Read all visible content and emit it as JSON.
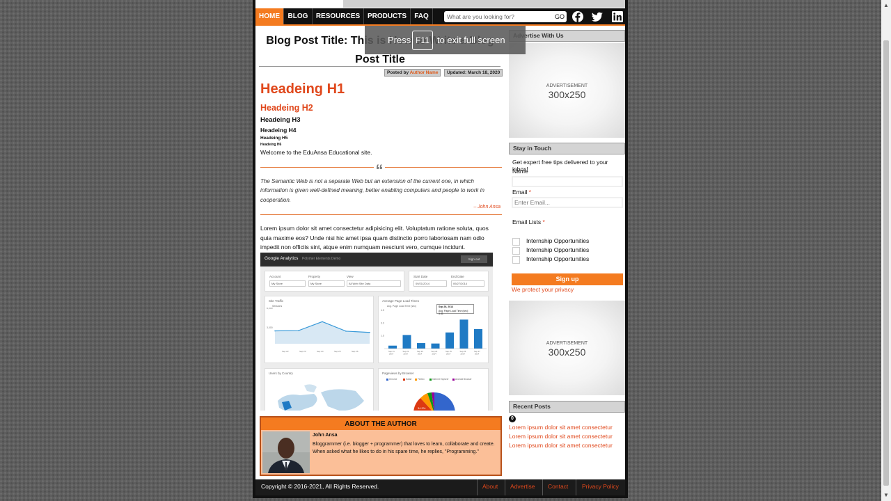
{
  "nav": {
    "items": [
      "HOME",
      "BLOG",
      "RESOURCES",
      "PRODUCTS",
      "FAQ"
    ],
    "active": "HOME",
    "search_placeholder": "What are you looking for?",
    "search_button": "GO",
    "social_icons": [
      "facebook-icon",
      "twitter-icon",
      "linkedin-icon"
    ]
  },
  "fullscreen_notice": {
    "press": "Press",
    "key": "F11",
    "tail": "to exit full screen"
  },
  "post": {
    "title": "Blog Post Title: This is How to Write a Blog Post Title",
    "posted_by_prefix": "Posted by",
    "author": "Author Name",
    "updated": "Updated: March 18, 2020",
    "h1": "Headeing H1",
    "h2": "Headeing H2",
    "h3": "Headeing H3",
    "h4": "Headeing H4",
    "h5": "Headeing H5",
    "h6": "Headeing H6",
    "welcome": "Welcome to the EduAnsa Educational site.",
    "quote": "The Semantic Web is not a separate Web but an extension of the current one, in which information is given well-defined meaning, better enabling computers and people to work in cooperation.",
    "quote_author": "–  John Ansa",
    "lorem": "Lorem ipsum dolor sit amet consectetur adipisicing elit. Voluptatum ratione soluta, quos quia maxime eos? Unde nisi hic amet ipsa quam distinctio porro laboriosam nam odio impedit non officiis sint, atque enim numquam nesciunt vero, cumque incidunt."
  },
  "analytics_image": {
    "title": "Google Analytics",
    "subtitle": "Polymer Elements Demo",
    "button": "Sign out",
    "labels": {
      "account": "Account",
      "property": "Property",
      "view": "View",
      "start": "Start Date",
      "end": "End Date",
      "account_val": "My Store",
      "property_val": "My Store",
      "view_val": "All Web Site Data",
      "start_val": "09/21/2014",
      "end_val": "09/27/2014",
      "traffic": "Site Traffic",
      "sessions": "Sessions",
      "load": "Average Page Load Times",
      "load_legend": "Avg. Page Load Time (sec)",
      "tooltip_date": "Sep 26, 2014",
      "tooltip_value": "Avg. Page Load Time (sec): 3.41",
      "country": "Users by Country",
      "browser": "Pageviews by Browser",
      "browsers": [
        "Chrome",
        "Safari",
        "Firefox",
        "Internet Explorer",
        "Android Browser"
      ],
      "pie_label": "34.3%"
    },
    "site_traffic_y": [
      "6,000",
      "3,000"
    ],
    "site_traffic_x": [
      "Sep 22",
      "Sep 23",
      "Sep 24",
      "Sep 25",
      "Sep 26"
    ],
    "site_traffic": [
      0.42,
      0.43,
      0.72,
      0.41,
      0.37
    ],
    "load_times_y": [
      "4.5",
      "3.0",
      "1.5"
    ],
    "load_times_x": [
      "Sep 21, 2014",
      "Sep 22, 2014",
      "Sep 23, 2014",
      "Sep 24, 2014",
      "Sep 25, 2014",
      "Sep 26, 2014",
      "Sep 27, 2014"
    ],
    "load_times": [
      0.35,
      1.6,
      0.65,
      0.6,
      1.9,
      3.41,
      2.3
    ]
  },
  "about": {
    "heading": "ABOUT THE AUTHOR",
    "name": "John Ansa",
    "bio": "Bloggrammer (i.e. blogger + programmer) that loves to learn, collaborate and create. When asked what he likes to do in his spare time, he replies, \"Programming.\""
  },
  "sidebar": {
    "advertise_heading": "Advertise With Us",
    "ad_label": "ADVERTISEMENT",
    "ad_size": "300x250",
    "stay_heading": "Stay in Touch",
    "stay_intro": "Get expert free tips delivered to your inbox!",
    "name_label": "Name",
    "email_label": "Email",
    "email_placeholder": "Enter Email...",
    "lists_label": "Email Lists",
    "lists": [
      "Internship Opportunities",
      "Internship Opportunities",
      "Internship Opportunities"
    ],
    "signup": "Sign up",
    "protect": "We protect your privacy",
    "recent_heading": "Recent Posts",
    "recent_count": "0",
    "recent_posts": [
      "Lorem ipsum dolor sit amet consectetur",
      "Lorem ipsum dolor sit amet consectetur",
      "Lorem ipsum dolor sit amet consectetur"
    ]
  },
  "footer": {
    "copyright": "Copyright © 2016-2021, All Rights Reserved.",
    "links": [
      "About",
      "Advertise",
      "Contact",
      "Privacy Policy"
    ]
  },
  "colors": {
    "accent": "#f47b20",
    "link": "#e0481c",
    "nav_bg": "#111111"
  }
}
